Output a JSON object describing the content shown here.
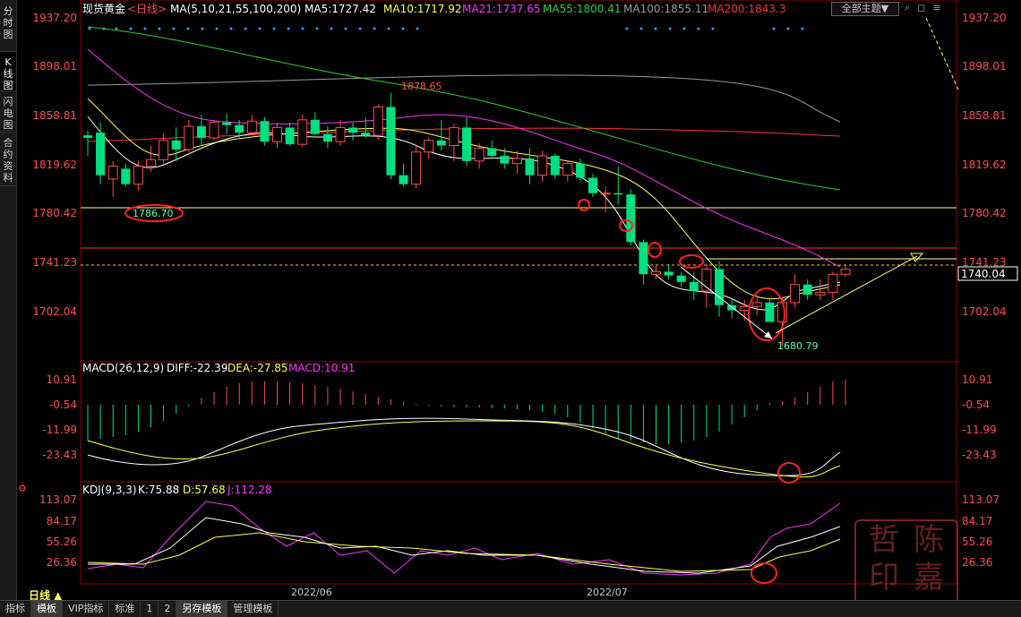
{
  "left_tabs": [
    "分时图",
    "K线图",
    "闪电图",
    "合约资料"
  ],
  "header": {
    "title": "现货黄金",
    "period": "<日线>",
    "ma_label": "MA(5,10,21,55,100,200)",
    "ma5": "MA5:1727.42",
    "ma10": "MA10:1717.92",
    "ma21": "MA21:1737.65",
    "ma55": "MA55:1800.41",
    "ma100": "MA100:1855.11",
    "ma200": "MA200:1843.3"
  },
  "theme_button": "全部主题▼",
  "price_axis": [
    "1937.20",
    "1898.01",
    "1858.81",
    "1819.62",
    "1780.42",
    "1741.23",
    "1702.04"
  ],
  "current_price": "1740.04",
  "annotations": {
    "high": "1878.65",
    "support": "1786.70",
    "low": "1680.79"
  },
  "macd": {
    "header": "MACD(26,12,9)",
    "diff": "DIFF:-22.39",
    "dea": "DEA:-27.85",
    "macd": "MACD:10.91",
    "axis": [
      "10.91",
      "-0.54",
      "-11.99",
      "-23.43"
    ]
  },
  "kdj": {
    "header": "KDJ(9,3,3)",
    "k": "K:75.88",
    "d": "D:57.68",
    "j": "J:112.28",
    "axis": [
      "113.07",
      "84.17",
      "55.26",
      "26.36"
    ]
  },
  "dates": [
    "2022/06",
    "2022/07"
  ],
  "period_label": "日线 ▲",
  "bottom_tabs": [
    "指标",
    "模板",
    "VIP指标",
    "标准",
    "1",
    "2",
    "另存模板",
    "管理模板"
  ],
  "watermark": [
    "哲",
    "陈",
    "印",
    "嘉"
  ],
  "colors": {
    "up": "#ff4d4d",
    "down": "#00e080",
    "ma5": "#ffffff",
    "ma10": "#ffff55",
    "ma21": "#ff33ff",
    "ma55": "#33cc33",
    "ma100": "#9a9a9a",
    "ma200": "#ff3333"
  },
  "chart_data": {
    "type": "candlestick",
    "ylim": [
      1670,
      1937.2
    ],
    "candles": [
      [
        1846,
        1850,
        1830,
        1844
      ],
      [
        1848,
        1856,
        1808,
        1815
      ],
      [
        1812,
        1826,
        1798,
        1822
      ],
      [
        1820,
        1824,
        1806,
        1808
      ],
      [
        1808,
        1826,
        1803,
        1822
      ],
      [
        1822,
        1838,
        1818,
        1827
      ],
      [
        1827,
        1847,
        1824,
        1842
      ],
      [
        1842,
        1852,
        1826,
        1835
      ],
      [
        1835,
        1858,
        1833,
        1853
      ],
      [
        1853,
        1862,
        1838,
        1844
      ],
      [
        1844,
        1858,
        1842,
        1856
      ],
      [
        1856,
        1863,
        1847,
        1854
      ],
      [
        1854,
        1858,
        1843,
        1848
      ],
      [
        1848,
        1862,
        1846,
        1857
      ],
      [
        1857,
        1860,
        1838,
        1841
      ],
      [
        1841,
        1856,
        1836,
        1852
      ],
      [
        1852,
        1856,
        1838,
        1839
      ],
      [
        1839,
        1862,
        1837,
        1858
      ],
      [
        1858,
        1864,
        1846,
        1847
      ],
      [
        1847,
        1853,
        1836,
        1841
      ],
      [
        1841,
        1858,
        1838,
        1852
      ],
      [
        1852,
        1856,
        1842,
        1848
      ],
      [
        1848,
        1860,
        1844,
        1846
      ],
      [
        1846,
        1870,
        1842,
        1868
      ],
      [
        1868,
        1879,
        1812,
        1815
      ],
      [
        1815,
        1824,
        1806,
        1808
      ],
      [
        1808,
        1838,
        1805,
        1833
      ],
      [
        1833,
        1844,
        1828,
        1842
      ],
      [
        1842,
        1858,
        1834,
        1838
      ],
      [
        1838,
        1855,
        1826,
        1852
      ],
      [
        1852,
        1860,
        1822,
        1826
      ],
      [
        1826,
        1840,
        1820,
        1836
      ],
      [
        1836,
        1842,
        1828,
        1830
      ],
      [
        1830,
        1836,
        1820,
        1824
      ],
      [
        1824,
        1834,
        1816,
        1828
      ],
      [
        1828,
        1836,
        1808,
        1815
      ],
      [
        1815,
        1834,
        1810,
        1830
      ],
      [
        1830,
        1832,
        1812,
        1815
      ],
      [
        1815,
        1826,
        1810,
        1824
      ],
      [
        1824,
        1828,
        1810,
        1813
      ],
      [
        1813,
        1816,
        1798,
        1801
      ],
      [
        1801,
        1806,
        1786,
        1801
      ],
      [
        1801,
        1822,
        1792,
        1800
      ],
      [
        1800,
        1804,
        1760,
        1763
      ],
      [
        1763,
        1765,
        1730,
        1738
      ],
      [
        1738,
        1746,
        1734,
        1740
      ],
      [
        1740,
        1746,
        1734,
        1737
      ],
      [
        1737,
        1740,
        1728,
        1732
      ],
      [
        1732,
        1740,
        1718,
        1725
      ],
      [
        1725,
        1746,
        1712,
        1742
      ],
      [
        1742,
        1748,
        1705,
        1714
      ],
      [
        1714,
        1718,
        1704,
        1710
      ],
      [
        1710,
        1718,
        1702,
        1713
      ],
      [
        1713,
        1722,
        1706,
        1716
      ],
      [
        1716,
        1720,
        1706,
        1701
      ],
      [
        1701,
        1720,
        1682,
        1716
      ],
      [
        1716,
        1738,
        1712,
        1730
      ],
      [
        1730,
        1734,
        1718,
        1722
      ],
      [
        1722,
        1734,
        1718,
        1724
      ],
      [
        1724,
        1740,
        1718,
        1738
      ],
      [
        1738,
        1745,
        1736,
        1742
      ]
    ]
  }
}
